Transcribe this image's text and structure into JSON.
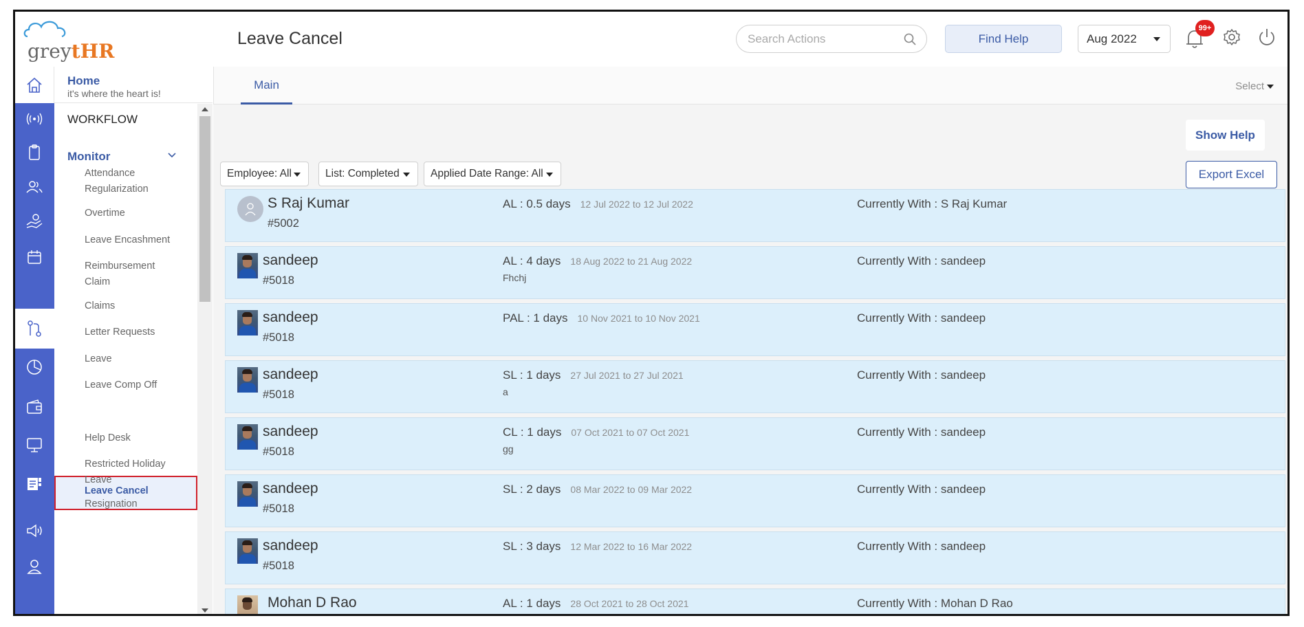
{
  "header": {
    "logo_part1": "grey",
    "logo_part2": "tHR",
    "logo_brand_color": "#e87722",
    "page_title": "Leave Cancel",
    "search_placeholder": "Search Actions",
    "find_help_label": "Find Help",
    "month_value": "Aug 2022",
    "notification_badge": "99+"
  },
  "home": {
    "title": "Home",
    "subtitle": "it's where the heart is!"
  },
  "rail": {
    "accent_color": "#4a63c9",
    "icons": [
      "home-icon",
      "broadcast-icon",
      "clipboard-icon",
      "people-icon",
      "hand-coin-icon",
      "calendar-icon",
      "workflow-icon",
      "pie-chart-icon",
      "wallet-icon",
      "monitor-icon",
      "document-icon",
      "megaphone-icon",
      "user-icon"
    ]
  },
  "menu": {
    "section_title": "WORKFLOW",
    "group_title": "Monitor",
    "items": [
      {
        "label": "Attendance\nRegularization"
      },
      {
        "label": "Overtime"
      },
      {
        "label": "Leave Encashment"
      },
      {
        "label": "Reimbursement\nClaim"
      },
      {
        "label": "Claims"
      },
      {
        "label": "Letter Requests"
      },
      {
        "label": "Leave"
      },
      {
        "label": "Leave Comp Off"
      },
      {
        "label": "Leave Cancel"
      },
      {
        "label": "Help Desk"
      },
      {
        "label": "Restricted Holiday\nLeave"
      },
      {
        "label": "Resignation"
      }
    ]
  },
  "tabs": {
    "main_label": "Main",
    "select_label": "Select"
  },
  "toolbar": {
    "show_help_label": "Show Help",
    "employee_filter": "Employee: All",
    "list_filter": "List: Completed",
    "date_filter": "Applied Date Range: All",
    "export_label": "Export Excel"
  },
  "rows": [
    {
      "name": "S Raj Kumar",
      "id": "#5002",
      "leave": "AL : 0.5 days",
      "dates": "12 Jul 2022 to 12 Jul 2022",
      "reason": "",
      "current_with": "Currently With : S Raj Kumar"
    },
    {
      "name": "sandeep",
      "id": "#5018",
      "leave": "AL : 4 days",
      "dates": "18 Aug 2022 to 21 Aug 2022",
      "reason": "Fhchj",
      "current_with": "Currently With : sandeep"
    },
    {
      "name": "sandeep",
      "id": "#5018",
      "leave": "PAL : 1 days",
      "dates": "10 Nov 2021 to 10 Nov 2021",
      "reason": "",
      "current_with": "Currently With : sandeep"
    },
    {
      "name": "sandeep",
      "id": "#5018",
      "leave": "SL : 1 days",
      "dates": "27 Jul 2021 to 27 Jul 2021",
      "reason": "a",
      "current_with": "Currently With : sandeep"
    },
    {
      "name": "sandeep",
      "id": "#5018",
      "leave": "CL : 1 days",
      "dates": "07 Oct 2021 to 07 Oct 2021",
      "reason": "gg",
      "current_with": "Currently With : sandeep"
    },
    {
      "name": "sandeep",
      "id": "#5018",
      "leave": "SL : 2 days",
      "dates": "08 Mar 2022 to 09 Mar 2022",
      "reason": "",
      "current_with": "Currently With : sandeep"
    },
    {
      "name": "sandeep",
      "id": "#5018",
      "leave": "SL : 3 days",
      "dates": "12 Mar 2022 to 16 Mar 2022",
      "reason": "",
      "current_with": "Currently With : sandeep"
    },
    {
      "name": "Mohan D Rao",
      "id": "",
      "leave": "AL : 1 days",
      "dates": "28 Oct 2021 to 28 Oct 2021",
      "reason": "",
      "current_with": "Currently With : Mohan D Rao"
    }
  ]
}
